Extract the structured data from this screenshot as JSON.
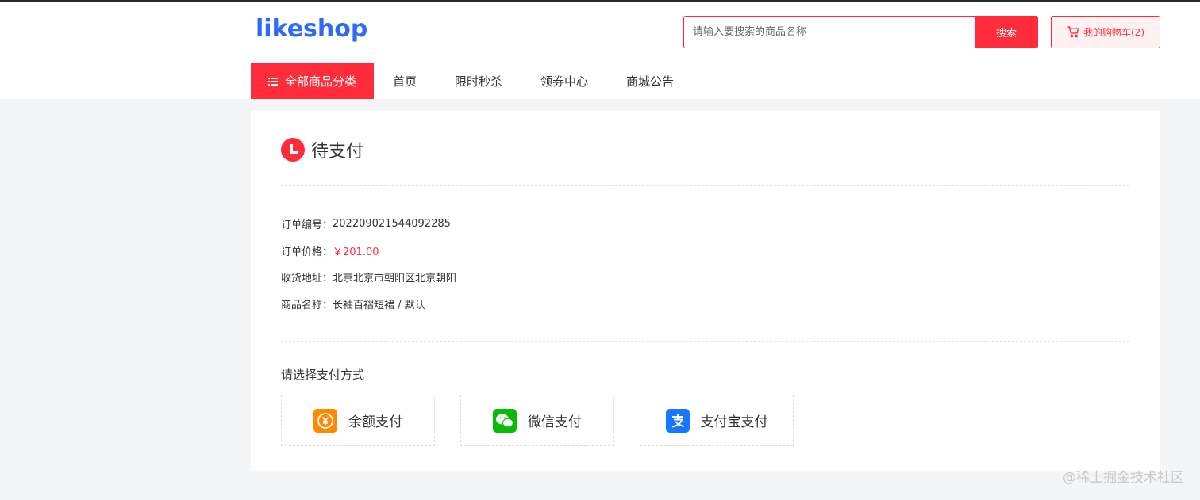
{
  "header": {
    "logo_text": "likeshop",
    "search": {
      "placeholder": "请输入要搜索的商品名称",
      "button_label": "搜索"
    },
    "cart": {
      "label": "我的购物车(2)",
      "icon": "cart-icon"
    }
  },
  "nav": {
    "categories_label": "全部商品分类",
    "items": [
      "首页",
      "限时秒杀",
      "领券中心",
      "商城公告"
    ]
  },
  "order": {
    "status": "待支付",
    "number_label": "订单编号：",
    "number_value": "202209021544092285",
    "price_label": "订单价格：",
    "price_value": "￥201.00",
    "address_label": "收货地址：",
    "address_value": "北京北京市朝阳区北京朝阳",
    "product_label": "商品名称：",
    "product_value": "长袖百褶短裙 /  默认"
  },
  "payment": {
    "title": "请选择支付方式",
    "options": [
      {
        "label": "余额支付",
        "icon": "balance-icon",
        "color": "#ff8a00"
      },
      {
        "label": "微信支付",
        "icon": "wechat-icon",
        "color": "#09bb07"
      },
      {
        "label": "支付宝支付",
        "icon": "alipay-icon",
        "color": "#1677ff"
      }
    ]
  },
  "watermark": "@稀土掘金技术社区",
  "colors": {
    "accent": "#ff2c3c",
    "logo": "#2f6bf2",
    "background": "#f4f5f7"
  }
}
